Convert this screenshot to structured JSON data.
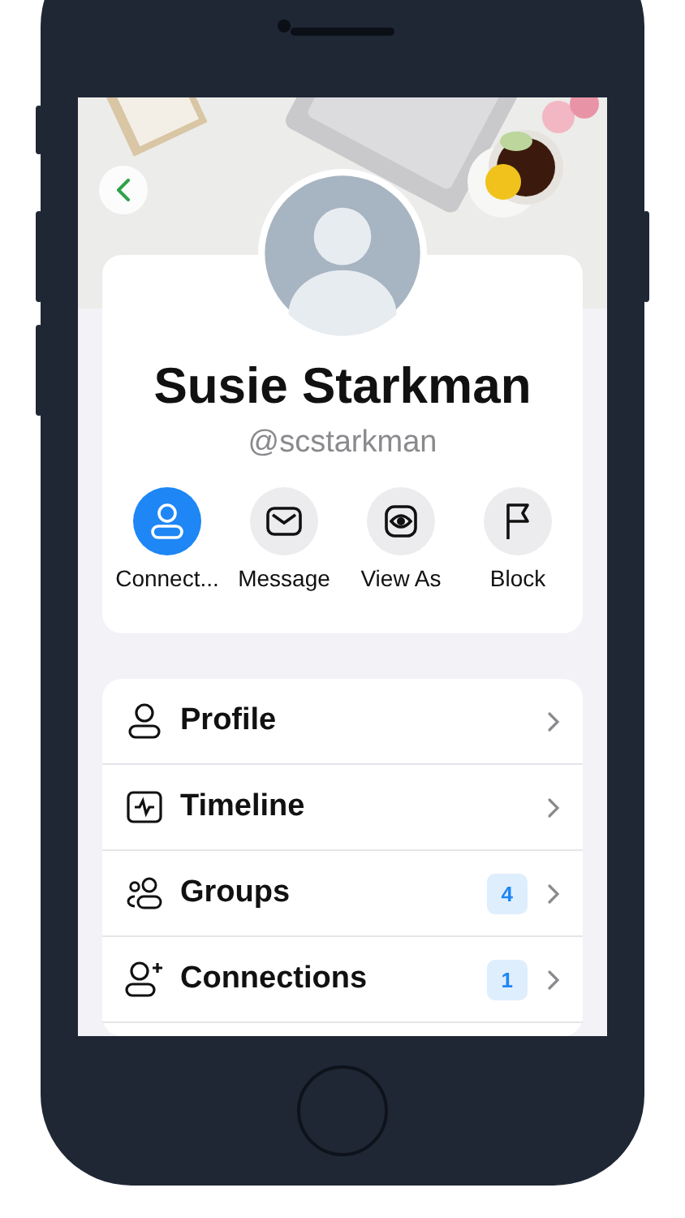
{
  "profile": {
    "name": "Susie Starkman",
    "handle": "@scstarkman"
  },
  "actions": [
    {
      "label": "Connect...",
      "kind": "person",
      "active": true
    },
    {
      "label": "Message",
      "kind": "envelope",
      "active": false
    },
    {
      "label": "View As",
      "kind": "eye",
      "active": false
    },
    {
      "label": "Block",
      "kind": "flag",
      "active": false
    }
  ],
  "menu": [
    {
      "label": "Profile",
      "kind": "person"
    },
    {
      "label": "Timeline",
      "kind": "activity"
    },
    {
      "label": "Groups",
      "kind": "group",
      "badge": "4"
    },
    {
      "label": "Connections",
      "kind": "person-plus",
      "badge": "1"
    }
  ]
}
